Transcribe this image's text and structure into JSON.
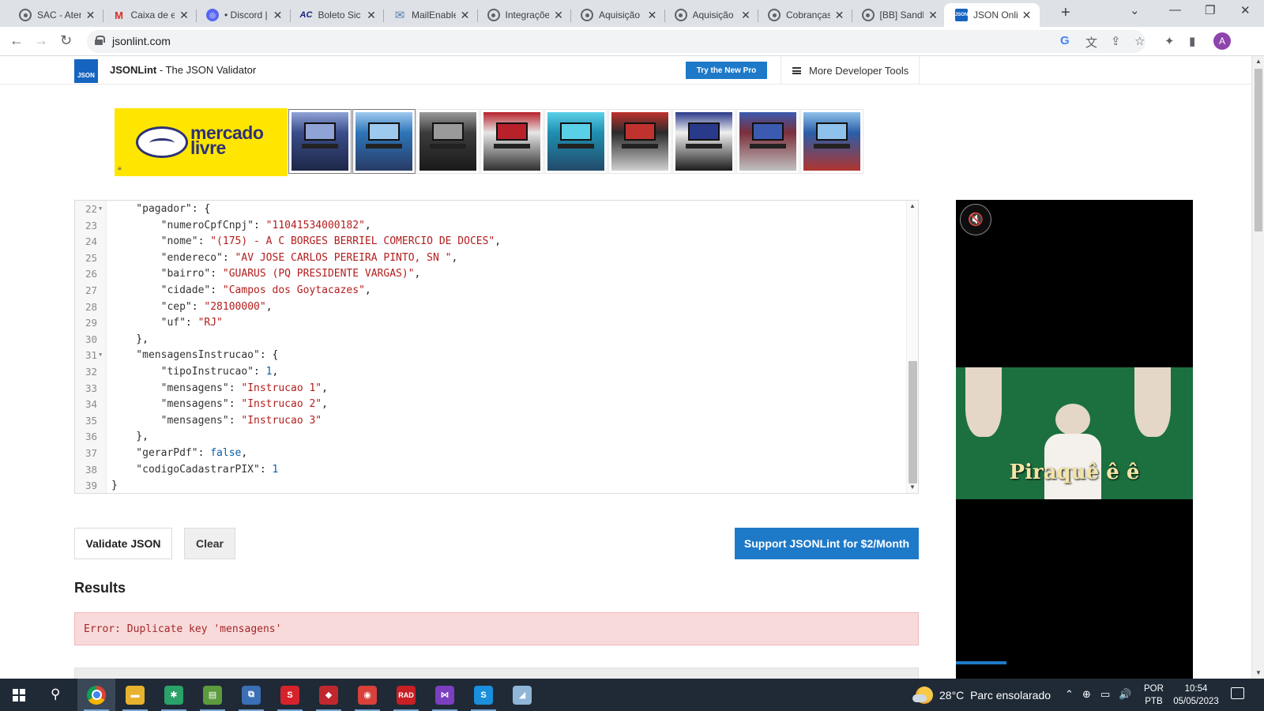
{
  "browser": {
    "tabs": [
      {
        "title": "SAC - Aten",
        "icon": "globe-icon"
      },
      {
        "title": "Caixa de e",
        "icon": "gmail-icon"
      },
      {
        "title": "• Discord |",
        "icon": "discord-icon"
      },
      {
        "title": "Boleto Sic",
        "icon": "ac-icon"
      },
      {
        "title": "MailEnable",
        "icon": "mail-icon"
      },
      {
        "title": "Integraçõe",
        "icon": "globe-icon"
      },
      {
        "title": "Aquisição",
        "icon": "globe-icon"
      },
      {
        "title": "Aquisição",
        "icon": "globe-icon"
      },
      {
        "title": "Cobranças",
        "icon": "globe-icon"
      },
      {
        "title": "[BB] Sandb",
        "icon": "globe-icon"
      },
      {
        "title": "JSON Onli",
        "icon": "json-icon",
        "active": true
      }
    ],
    "url": "jsonlint.com",
    "profile_initial": "A",
    "icons": {
      "new_tab": "+",
      "minimize": "—",
      "maximize": "❐",
      "close": "✕",
      "chevron": "⌄",
      "back": "←",
      "forward": "→",
      "reload": "↻",
      "google": "G",
      "translate": "文",
      "share": "⇪",
      "bookmark": "☆",
      "extensions": "✦",
      "sidepanel": "▮"
    }
  },
  "site": {
    "logo_text": "JSON",
    "brand_name": "JSONLint",
    "brand_tagline": " - The JSON Validator",
    "try_pro": "Try the New Pro",
    "more_tools": "More Developer Tools"
  },
  "ad": {
    "brand_line1": "mercado",
    "brand_line2": "livre",
    "ad_marker": "≡",
    "thumb_count": 9
  },
  "editor": {
    "lines": [
      {
        "n": "22",
        "fold": true,
        "tokens": [
          [
            "k",
            "    \"pagador\""
          ],
          [
            "p",
            ": {"
          ]
        ]
      },
      {
        "n": "23",
        "tokens": [
          [
            "k",
            "        \"numeroCpfCnpj\""
          ],
          [
            "p",
            ": "
          ],
          [
            "s",
            "\"11041534000182\""
          ],
          [
            "p",
            ","
          ]
        ]
      },
      {
        "n": "24",
        "tokens": [
          [
            "k",
            "        \"nome\""
          ],
          [
            "p",
            ": "
          ],
          [
            "s",
            "\"(175) - A C BORGES BERRIEL COMERCIO DE DOCES\""
          ],
          [
            "p",
            ","
          ]
        ]
      },
      {
        "n": "25",
        "tokens": [
          [
            "k",
            "        \"endereco\""
          ],
          [
            "p",
            ": "
          ],
          [
            "s",
            "\"AV JOSE CARLOS PEREIRA PINTO, SN \""
          ],
          [
            "p",
            ","
          ]
        ]
      },
      {
        "n": "26",
        "tokens": [
          [
            "k",
            "        \"bairro\""
          ],
          [
            "p",
            ": "
          ],
          [
            "s",
            "\"GUARUS (PQ PRESIDENTE VARGAS)\""
          ],
          [
            "p",
            ","
          ]
        ]
      },
      {
        "n": "27",
        "tokens": [
          [
            "k",
            "        \"cidade\""
          ],
          [
            "p",
            ": "
          ],
          [
            "s",
            "\"Campos dos Goytacazes\""
          ],
          [
            "p",
            ","
          ]
        ]
      },
      {
        "n": "28",
        "tokens": [
          [
            "k",
            "        \"cep\""
          ],
          [
            "p",
            ": "
          ],
          [
            "s",
            "\"28100000\""
          ],
          [
            "p",
            ","
          ]
        ]
      },
      {
        "n": "29",
        "tokens": [
          [
            "k",
            "        \"uf\""
          ],
          [
            "p",
            ": "
          ],
          [
            "s",
            "\"RJ\""
          ]
        ]
      },
      {
        "n": "30",
        "tokens": [
          [
            "p",
            "    },"
          ]
        ]
      },
      {
        "n": "31",
        "fold": true,
        "tokens": [
          [
            "k",
            "    \"mensagensInstrucao\""
          ],
          [
            "p",
            ": {"
          ]
        ]
      },
      {
        "n": "32",
        "tokens": [
          [
            "k",
            "        \"tipoInstrucao\""
          ],
          [
            "p",
            ": "
          ],
          [
            "n",
            "1"
          ],
          [
            "p",
            ","
          ]
        ]
      },
      {
        "n": "33",
        "tokens": [
          [
            "k",
            "        \"mensagens\""
          ],
          [
            "p",
            ": "
          ],
          [
            "s",
            "\"Instrucao 1\""
          ],
          [
            "p",
            ","
          ]
        ]
      },
      {
        "n": "34",
        "tokens": [
          [
            "k",
            "        \"mensagens\""
          ],
          [
            "p",
            ": "
          ],
          [
            "s",
            "\"Instrucao 2\""
          ],
          [
            "p",
            ","
          ]
        ]
      },
      {
        "n": "35",
        "tokens": [
          [
            "k",
            "        \"mensagens\""
          ],
          [
            "p",
            ": "
          ],
          [
            "s",
            "\"Instrucao 3\""
          ]
        ]
      },
      {
        "n": "36",
        "tokens": [
          [
            "p",
            "    },"
          ]
        ]
      },
      {
        "n": "37",
        "tokens": [
          [
            "k",
            "    \"gerarPdf\""
          ],
          [
            "p",
            ": "
          ],
          [
            "c",
            "false"
          ],
          [
            "p",
            ","
          ]
        ]
      },
      {
        "n": "38",
        "tokens": [
          [
            "k",
            "    \"codigoCadastrarPIX\""
          ],
          [
            "p",
            ": "
          ],
          [
            "n",
            "1"
          ]
        ]
      },
      {
        "n": "39",
        "tokens": [
          [
            "p",
            "}"
          ]
        ]
      }
    ]
  },
  "actions": {
    "validate": "Validate JSON",
    "clear": "Clear",
    "support": "Support JSONLint for $2/Month"
  },
  "results": {
    "heading": "Results",
    "error": "Error: Duplicate key 'mensagens'"
  },
  "video_ad": {
    "caption": "Piraquê  ê  ê",
    "mute_icon": "🔇"
  },
  "taskbar": {
    "apps": [
      {
        "name": "chrome",
        "running": true,
        "active": true
      },
      {
        "name": "explorer",
        "running": true,
        "label": "▬",
        "color": "#e8b12e"
      },
      {
        "name": "slack",
        "running": true,
        "label": "✱",
        "color": "#2aa26a"
      },
      {
        "name": "excel-like",
        "running": true,
        "label": "▤",
        "color": "#5c9b3d"
      },
      {
        "name": "tool",
        "running": true,
        "label": "⧉",
        "color": "#3b6fb6"
      },
      {
        "name": "app-s",
        "running": true,
        "label": "S",
        "color": "#d6222b"
      },
      {
        "name": "app-red",
        "running": true,
        "label": "◆",
        "color": "#c0282e"
      },
      {
        "name": "delphi",
        "running": true,
        "label": "◉",
        "color": "#d8403a"
      },
      {
        "name": "rad",
        "running": true,
        "label": "RAD",
        "color": "#c81f25"
      },
      {
        "name": "visual-studio",
        "running": true,
        "label": "⋈",
        "color": "#7b3fbf"
      },
      {
        "name": "skype",
        "running": true,
        "label": "S",
        "color": "#1a8fdc"
      },
      {
        "name": "notes",
        "running": false,
        "label": "◢",
        "color": "#8fb6d6"
      }
    ],
    "weather_temp": "28°C",
    "weather_text": "Parc ensolarado",
    "lang_line1": "POR",
    "lang_line2": "PTB",
    "time": "10:54",
    "date": "05/05/2023",
    "tray_icons": [
      "⌃",
      "⊕",
      "▭",
      "🔊"
    ]
  },
  "colors": {
    "accent": "#1e7ac8",
    "error_bg": "#f9dada",
    "error_text": "#a3272b",
    "string": "#b31d1d",
    "number": "#0b5fa5",
    "ml_yellow": "#ffe600"
  }
}
